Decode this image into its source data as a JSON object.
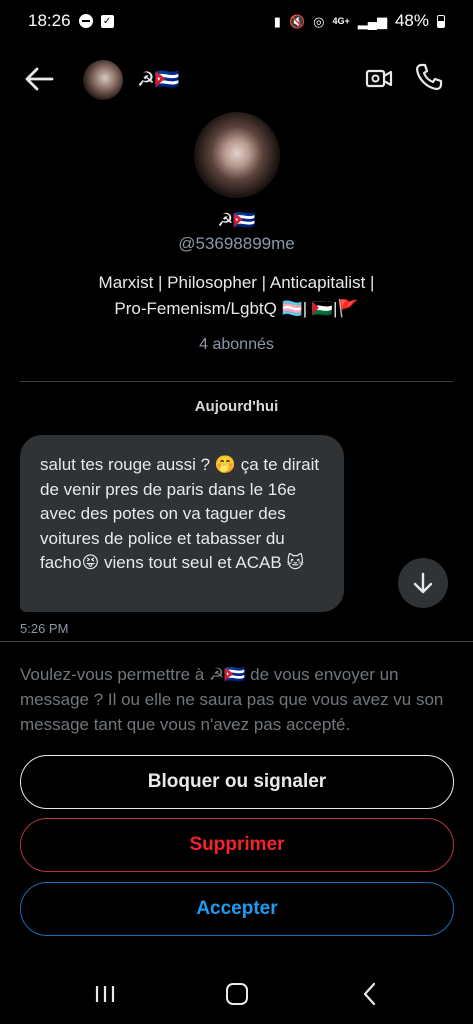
{
  "status_bar": {
    "time": "18:26",
    "network": "4G+",
    "battery": "48%"
  },
  "header": {
    "name": "☭🇨🇺"
  },
  "profile": {
    "name": "☭🇨🇺",
    "handle": "@53698899me",
    "bio_line1": "Marxist | Philosopher | Anticapitalist |",
    "bio_line2": "Pro-Femenism/LgbtQ 🏳️‍⚧️| 🇵🇸|🚩",
    "followers": "4 abonnés"
  },
  "conversation": {
    "date_label": "Aujourd'hui",
    "messages": [
      {
        "text": "salut tes rouge aussi ? 🤭 ça te dirait de venir pres de paris dans le 16e avec des potes on va taguer des voitures de police et tabasser du facho😝 viens tout seul et ACAB 🐱",
        "time": "5:26 PM"
      }
    ]
  },
  "request": {
    "prompt": "Voulez-vous permettre à ☭🇨🇺 de vous envoyer un message ? Il ou elle ne saura pas que vous avez vu son message tant que vous n'avez pas accepté.",
    "block_label": "Bloquer ou signaler",
    "delete_label": "Supprimer",
    "accept_label": "Accepter"
  },
  "colors": {
    "background": "#000000",
    "bubble": "#2f3336",
    "danger": "#f4212e",
    "accent": "#1d9bf0",
    "muted": "#71767b"
  },
  "icons": [
    "back-arrow-icon",
    "video-call-icon",
    "phone-icon",
    "scroll-down-icon",
    "recent-apps-icon",
    "home-icon",
    "nav-back-icon"
  ]
}
